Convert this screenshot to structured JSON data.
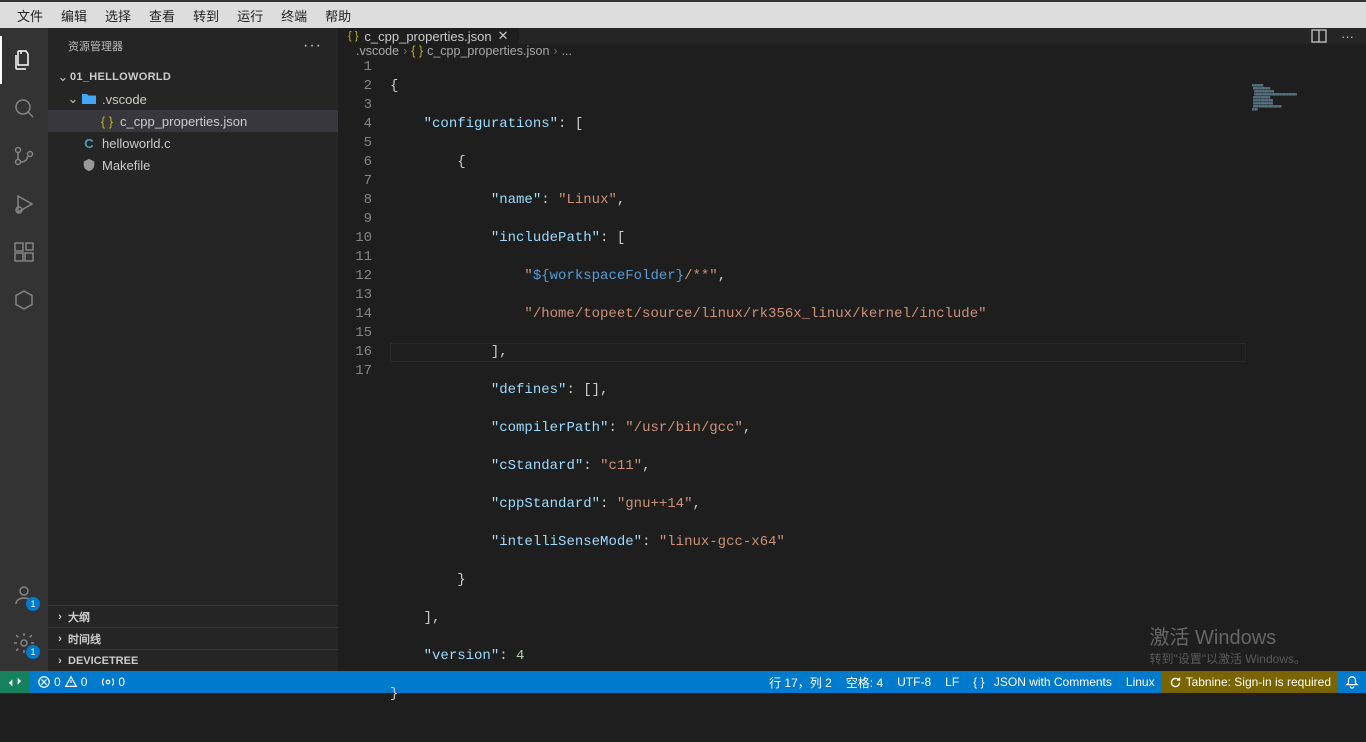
{
  "menubar": [
    "文件",
    "编辑",
    "选择",
    "查看",
    "转到",
    "运行",
    "终端",
    "帮助"
  ],
  "sidebar": {
    "title": "资源管理器",
    "folder": "01_HELLOWORLD",
    "vscode_folder": ".vscode",
    "files": {
      "c_cpp_properties": "c_cpp_properties.json",
      "helloworld": "helloworld.c",
      "makefile": "Makefile"
    },
    "panels": [
      "大纲",
      "时间线",
      "DEVICETREE"
    ]
  },
  "tab": {
    "filename": "c_cpp_properties.json"
  },
  "breadcrumb": {
    "seg1": ".vscode",
    "seg2": "c_cpp_properties.json",
    "seg3": "..."
  },
  "code": {
    "lines": [
      1,
      2,
      3,
      4,
      5,
      6,
      7,
      8,
      9,
      10,
      11,
      12,
      13,
      14,
      15,
      16,
      17
    ],
    "content": {
      "L1": "{",
      "L2_key": "\"configurations\"",
      "L3": "{",
      "L4_key": "\"name\"",
      "L4_val": "\"Linux\"",
      "L5_key": "\"includePath\"",
      "L6_val": "\"${workspaceFolder}/**\"",
      "L6_tmpl": "workspaceFolder",
      "L7_val": "\"/home/topeet/source/linux/rk356x_linux/kernel/include\"",
      "L8": "],",
      "L9_key": "\"defines\"",
      "L10_key": "\"compilerPath\"",
      "L10_val": "\"/usr/bin/gcc\"",
      "L11_key": "\"cStandard\"",
      "L11_val": "\"c11\"",
      "L12_key": "\"cppStandard\"",
      "L12_val": "\"gnu++14\"",
      "L13_key": "\"intelliSenseMode\"",
      "L13_val": "\"linux-gcc-x64\"",
      "L14": "}",
      "L15": "],",
      "L16_key": "\"version\"",
      "L16_val": "4",
      "L17": "}"
    }
  },
  "status": {
    "errors": "0",
    "warnings": "0",
    "ports": "0",
    "ln": "行 17，列 2",
    "spaces": "空格: 4",
    "encoding": "UTF-8",
    "eol": "LF",
    "lang": "JSON with Comments",
    "seq": "Linux",
    "tabnine": "Tabnine: Sign-in is required"
  },
  "watermark": {
    "title": "激活 Windows",
    "sub": "转到\"设置\"以激活 Windows。"
  },
  "badges": {
    "accounts": "1",
    "settings": "1"
  }
}
